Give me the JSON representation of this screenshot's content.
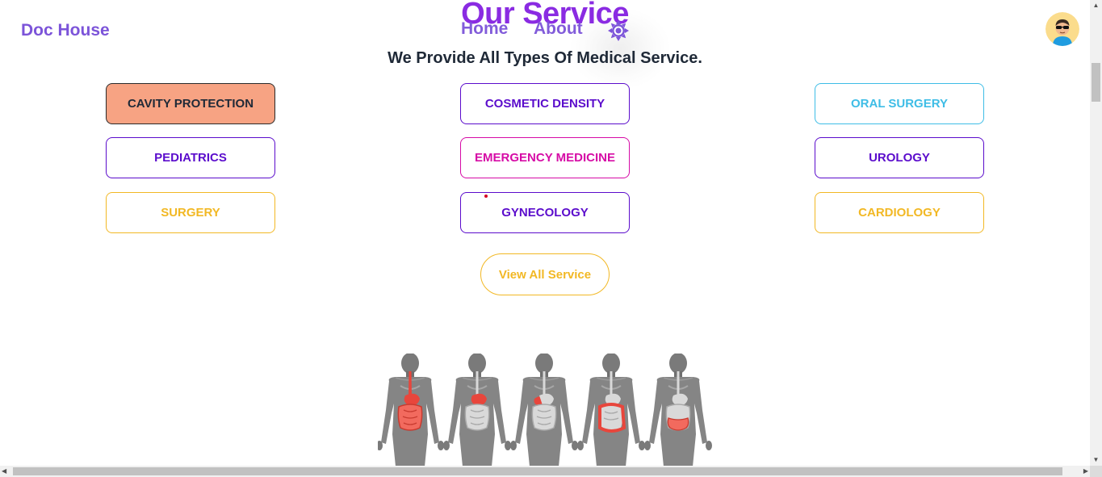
{
  "navbar": {
    "brand": "Doc House",
    "links": [
      "Home",
      "About"
    ],
    "theme_icon": "sun-icon",
    "avatar_icon": "user-avatar"
  },
  "services": {
    "title": "Our Service",
    "subtitle": "We Provide All Types Of Medical Service.",
    "items": [
      {
        "label": "CAVITY PROTECTION",
        "state": "active",
        "color": "#f7a383"
      },
      {
        "label": "COSMETIC DENSITY",
        "color": "#5b0ccc"
      },
      {
        "label": "ORAL SURGERY",
        "color": "#3ebde6"
      },
      {
        "label": "PEDIATRICS",
        "color": "#5b0ccc"
      },
      {
        "label": "EMERGENCY MEDICINE",
        "color": "#d60ba6"
      },
      {
        "label": "UROLOGY",
        "color": "#5b0ccc"
      },
      {
        "label": "SURGERY",
        "color": "#f2b824"
      },
      {
        "label": "GYNECOLOGY",
        "color": "#5b0ccc"
      },
      {
        "label": "CARDIOLOGY",
        "color": "#f2b824"
      }
    ],
    "view_all": "View All Service",
    "illustration": "human-digestive-system-anatomy"
  },
  "colors": {
    "brand": "#7c54d9",
    "title": "#8a2be2",
    "accent": "#f2b824"
  }
}
